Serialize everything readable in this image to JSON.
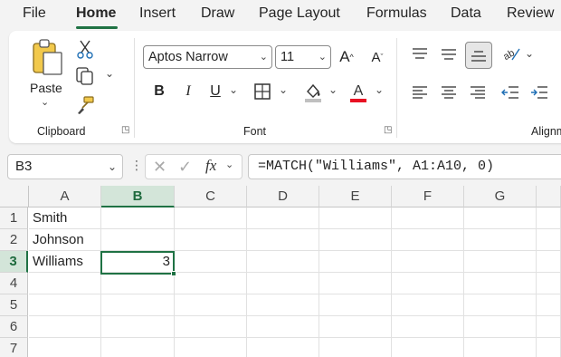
{
  "tabs": [
    {
      "label": "File"
    },
    {
      "label": "Home"
    },
    {
      "label": "Insert"
    },
    {
      "label": "Draw"
    },
    {
      "label": "Page Layout"
    },
    {
      "label": "Formulas"
    },
    {
      "label": "Data"
    },
    {
      "label": "Review"
    }
  ],
  "active_tab": "Home",
  "ribbon": {
    "clipboard": {
      "label": "Clipboard",
      "paste_label": "Paste"
    },
    "font": {
      "label": "Font",
      "font_name": "Aptos Narrow",
      "font_size": "11"
    },
    "alignment": {
      "label": "Alignm"
    }
  },
  "formula_bar": {
    "name_box": "B3",
    "formula": "=MATCH(\"Williams\", A1:A10, 0)"
  },
  "sheet": {
    "columns": [
      "A",
      "B",
      "C",
      "D",
      "E",
      "F",
      "G"
    ],
    "rows": [
      "1",
      "2",
      "3",
      "4",
      "5",
      "6",
      "7"
    ],
    "cells": {
      "A1": "Smith",
      "A2": "Johnson",
      "A3": "Williams",
      "B3": "3"
    },
    "active_cell": "B3"
  },
  "colors": {
    "accent": "#1f7244",
    "selected_header": "#d3e5d9",
    "font_color_bar": "#e81123",
    "fill_color_bar": "#c0c0c0"
  }
}
